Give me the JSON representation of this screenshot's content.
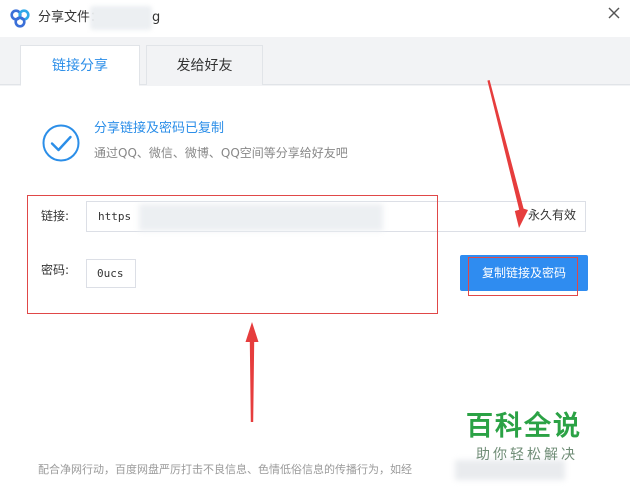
{
  "window": {
    "title": "分享文件：",
    "title_tail": "g",
    "close_icon": "close-icon"
  },
  "tabs": [
    {
      "label": "链接分享",
      "active": true
    },
    {
      "label": "发给好友",
      "active": false
    }
  ],
  "success": {
    "title": "分享链接及密码已复制",
    "description": "通过QQ、微信、微博、QQ空间等分享给好友吧"
  },
  "link": {
    "label": "链接:",
    "value_prefix": "https",
    "expiry": "永久有效"
  },
  "password": {
    "label": "密码:",
    "value": "0ucs"
  },
  "copy_button": {
    "label": "复制链接及密码"
  },
  "footer": {
    "notice": "配合净网行动，百度网盘严厉打击不良信息、色情低俗信息的传播行为，如经"
  },
  "watermark": {
    "title": "百科全说",
    "subtitle": "助你轻松解决"
  },
  "colors": {
    "accent": "#2b8ee8",
    "button": "#2f8cf0",
    "annotation": "#e04848",
    "watermark": "#2ba245"
  }
}
